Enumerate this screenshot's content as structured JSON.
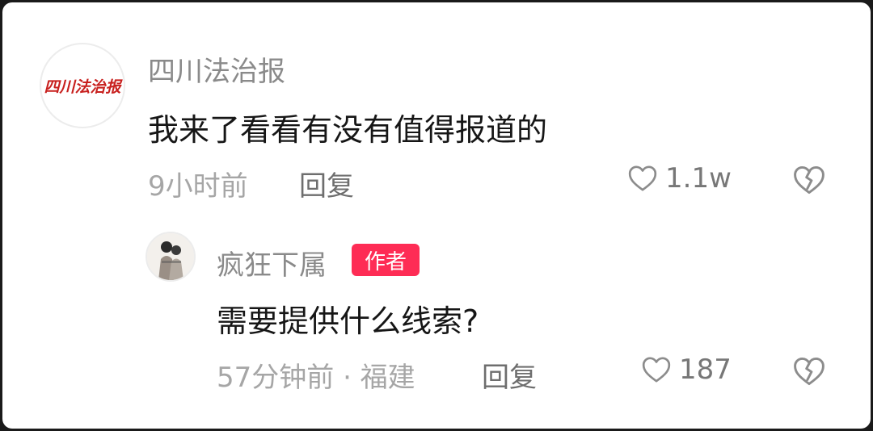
{
  "comments": [
    {
      "avatar_text": "四川法治报",
      "username": "四川法治报",
      "text": "我来了看看有没有值得报道的",
      "meta": "9小时前",
      "reply_label": "回复",
      "likes": "1.1w"
    },
    {
      "username": "疯狂下属",
      "badge": "作者",
      "text": "需要提供什么线索?",
      "meta": "57分钟前 · 福建",
      "reply_label": "回复",
      "likes": "187"
    }
  ],
  "colors": {
    "badge": "#fe2c55",
    "logo": "#c8201e"
  }
}
